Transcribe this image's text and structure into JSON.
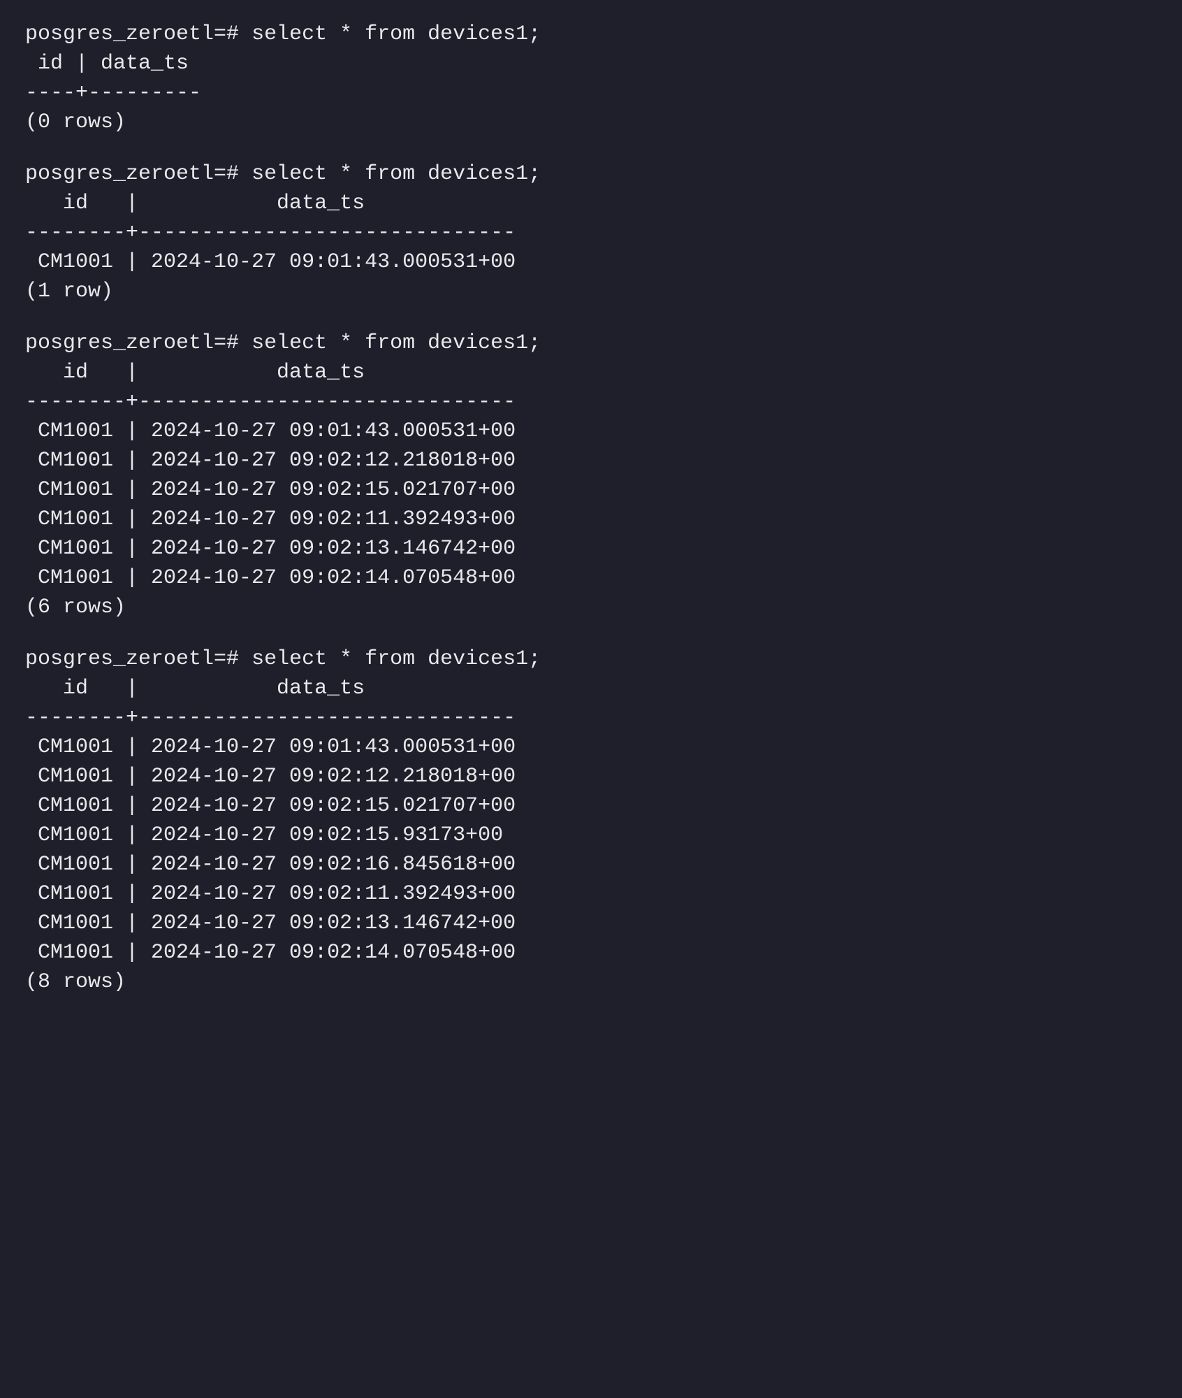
{
  "prompt": "posgres_zeroetl=#",
  "command": "select * from devices1;",
  "queries": [
    {
      "header": " id | data_ts ",
      "divider": "----+---------",
      "rows": [],
      "rowcount_label": "(0 rows)"
    },
    {
      "header": "   id   |           data_ts            ",
      "divider": "--------+------------------------------",
      "rows": [
        " CM1001 | 2024-10-27 09:01:43.000531+00"
      ],
      "rowcount_label": "(1 row)"
    },
    {
      "header": "   id   |           data_ts            ",
      "divider": "--------+------------------------------",
      "rows": [
        " CM1001 | 2024-10-27 09:01:43.000531+00",
        " CM1001 | 2024-10-27 09:02:12.218018+00",
        " CM1001 | 2024-10-27 09:02:15.021707+00",
        " CM1001 | 2024-10-27 09:02:11.392493+00",
        " CM1001 | 2024-10-27 09:02:13.146742+00",
        " CM1001 | 2024-10-27 09:02:14.070548+00"
      ],
      "rowcount_label": "(6 rows)"
    },
    {
      "header": "   id   |           data_ts            ",
      "divider": "--------+------------------------------",
      "rows": [
        " CM1001 | 2024-10-27 09:01:43.000531+00",
        " CM1001 | 2024-10-27 09:02:12.218018+00",
        " CM1001 | 2024-10-27 09:02:15.021707+00",
        " CM1001 | 2024-10-27 09:02:15.93173+00",
        " CM1001 | 2024-10-27 09:02:16.845618+00",
        " CM1001 | 2024-10-27 09:02:11.392493+00",
        " CM1001 | 2024-10-27 09:02:13.146742+00",
        " CM1001 | 2024-10-27 09:02:14.070548+00"
      ],
      "rowcount_label": "(8 rows)"
    }
  ]
}
